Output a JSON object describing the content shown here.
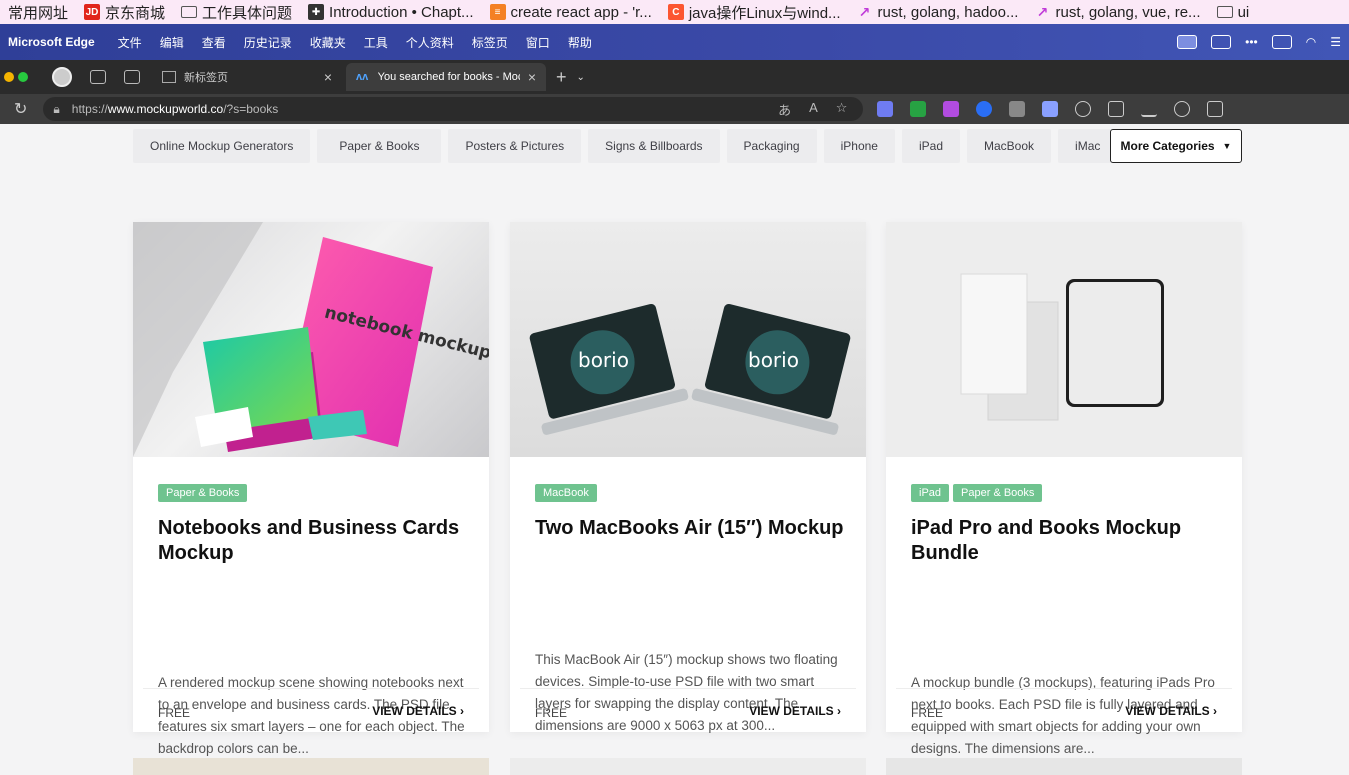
{
  "bookmarks": [
    {
      "label": "常用网址",
      "icon": "none"
    },
    {
      "label": "京东商城",
      "icon": "jd-icon"
    },
    {
      "label": "工作具体问题",
      "icon": "folder-icon"
    },
    {
      "label": "Introduction • Chapt...",
      "icon": "cross-icon"
    },
    {
      "label": "create react app - 'r...",
      "icon": "stackoverflow-icon"
    },
    {
      "label": "java操作Linux与wind...",
      "icon": "csdn-icon"
    },
    {
      "label": "rust, golang, hadoo...",
      "icon": "trend-icon"
    },
    {
      "label": "rust, golang, vue, re...",
      "icon": "trend-icon"
    },
    {
      "label": "ui",
      "icon": "folder-icon"
    }
  ],
  "mac_menu": {
    "app": "Microsoft Edge",
    "items": [
      "文件",
      "编辑",
      "查看",
      "历史记录",
      "收藏夹",
      "工具",
      "个人资料",
      "标签页",
      "窗口",
      "帮助"
    ]
  },
  "tabs": [
    {
      "title": "新标签页",
      "active": false
    },
    {
      "title": "You searched for books - Mock",
      "active": true
    }
  ],
  "address": {
    "prefix": "https://",
    "host": "www.mockupworld.co",
    "path": "/?s=books"
  },
  "categories": [
    "Online Mockup Generators",
    "Paper & Books",
    "Posters & Pictures",
    "Signs & Billboards",
    "Packaging",
    "iPhone",
    "iPad",
    "MacBook",
    "iMac"
  ],
  "more_categories": "More Categories",
  "cards": [
    {
      "tags": [
        "Paper & Books"
      ],
      "title": "Notebooks and Business Cards Mockup",
      "desc": "A rendered mockup scene showing notebooks next to an envelope and business cards. The PSD file features six smart layers – one for each object. The backdrop colors can be...",
      "price": "FREE",
      "cta": "VIEW DETAILS",
      "image_text": "notebook mockup"
    },
    {
      "tags": [
        "MacBook"
      ],
      "title": "Two MacBooks Air (15″) Mockup",
      "desc": "This MacBook Air (15″) mockup shows two floating devices. Simple-to-use PSD file with two smart layers for swapping the display content. The dimensions are 9000 x 5063 px at 300...",
      "price": "FREE",
      "cta": "VIEW DETAILS",
      "image_text": "borio"
    },
    {
      "tags": [
        "iPad",
        "Paper & Books"
      ],
      "title": "iPad Pro and Books Mockup Bundle",
      "desc": "A mockup bundle (3 mockups), featuring iPads Pro next to books. Each PSD file is fully layered and equipped with smart objects for adding your own designs. The dimensions are...",
      "price": "FREE",
      "cta": "VIEW DETAILS"
    }
  ],
  "colors": {
    "tag": "#6fc38f",
    "menu_bar": "#3b4aa8",
    "bookmark_bar": "#fbe9f7"
  }
}
